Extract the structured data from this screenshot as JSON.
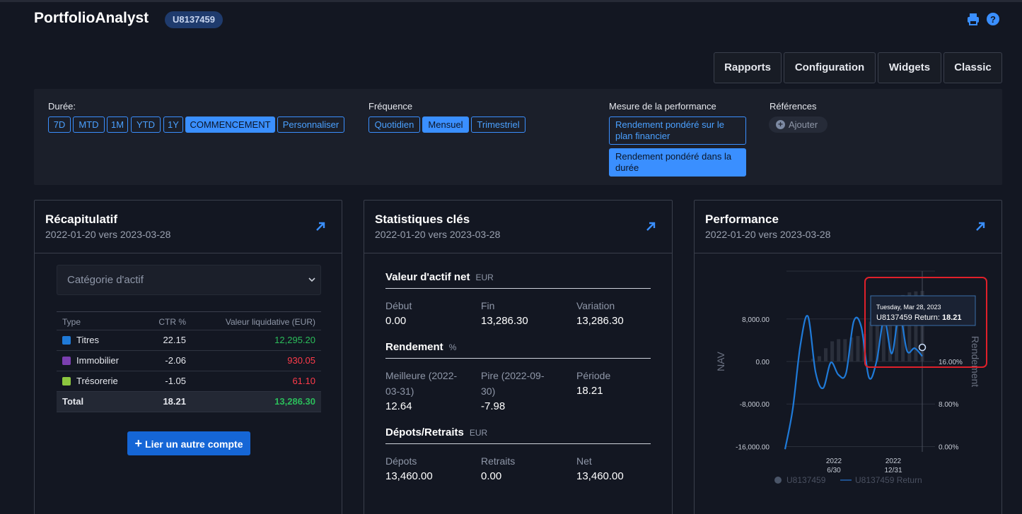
{
  "header": {
    "app_title": "PortfolioAnalyst",
    "account_badge": "U8137459",
    "icons": [
      "print-icon",
      "help-icon"
    ]
  },
  "nav": {
    "buttons": [
      "Rapports",
      "Configuration",
      "Widgets",
      "Classic"
    ]
  },
  "filters": {
    "duration": {
      "label": "Durée:",
      "options": [
        "7D",
        "MTD",
        "1M",
        "YTD",
        "1Y",
        "COMMENCEMENT",
        "Personnaliser"
      ],
      "selected": "COMMENCEMENT"
    },
    "frequency": {
      "label": "Fréquence",
      "options": [
        "Quotidien",
        "Mensuel",
        "Trimestriel"
      ],
      "selected": "Mensuel"
    },
    "measure": {
      "label": "Mesure de la performance",
      "options": [
        "Rendement pondéré sur le plan financier",
        "Rendement pondéré dans la durée"
      ],
      "selected": "Rendement pondéré dans la durée"
    },
    "references": {
      "label": "Références",
      "add_label": "Ajouter"
    }
  },
  "summary": {
    "title": "Récapitulatif",
    "subtitle": "2022-01-20 vers 2023-03-28",
    "select_placeholder": "Catégorie d'actif",
    "columns": [
      "Type",
      "CTR %",
      "Valeur liquidative (EUR)"
    ],
    "rows": [
      {
        "type": "Titres",
        "ctr": "22.15",
        "value": "12,295.20",
        "swatch": "#1f7ad8",
        "value_color": "green"
      },
      {
        "type": "Immobilier",
        "ctr": "-2.06",
        "value": "930.05",
        "swatch": "#7b3fb0",
        "value_color": "red"
      },
      {
        "type": "Trésorerie",
        "ctr": "-1.05",
        "value": "61.10",
        "swatch": "#8cc63f",
        "value_color": "red"
      }
    ],
    "total": {
      "type": "Total",
      "ctr": "18.21",
      "value": "13,286.30"
    },
    "link_button": "Lier un autre compte"
  },
  "stats": {
    "title": "Statistiques clés",
    "subtitle": "2022-01-20 vers 2023-03-28",
    "nav_section": {
      "title": "Valeur d'actif net",
      "unit": "EUR",
      "items": [
        {
          "label": "Début",
          "value": "0.00"
        },
        {
          "label": "Fin",
          "value": "13,286.30"
        },
        {
          "label": "Variation",
          "value": "13,286.30"
        }
      ]
    },
    "return_section": {
      "title": "Rendement",
      "unit": "%",
      "items": [
        {
          "label": "Meilleure (2022-03-31)",
          "value": "12.64"
        },
        {
          "label": "Pire (2022-09-30)",
          "value": "-7.98"
        },
        {
          "label": "Période",
          "value": "18.21"
        }
      ]
    },
    "flow_section": {
      "title": "Dépots/Retraits",
      "unit": "EUR",
      "items": [
        {
          "label": "Dépots",
          "value": "13,460.00"
        },
        {
          "label": "Retraits",
          "value": "0.00"
        },
        {
          "label": "Net",
          "value": "13,460.00"
        }
      ]
    }
  },
  "performance": {
    "title": "Performance",
    "subtitle": "2022-01-20 vers 2023-03-28",
    "tooltip": {
      "date": "Tuesday, Mar 28, 2023",
      "series_label": "U8137459 Return:",
      "value": "18.21"
    }
  },
  "chart_data": {
    "type": "line",
    "x_tick_labels": [
      [
        "2022",
        "6/30"
      ],
      [
        "2022",
        "12/31"
      ]
    ],
    "left_axis": {
      "label": "NAV",
      "ticks": [
        "8,000.00",
        "0.00",
        "-8,000.00",
        "-16,000.00"
      ],
      "tick_values": [
        8000,
        0,
        -8000,
        -16000
      ],
      "ylim": [
        -17000,
        17000
      ]
    },
    "right_axis": {
      "label": "Rendement",
      "ticks": [
        "16.00%",
        "8.00%",
        "0.00%"
      ],
      "tick_values": [
        16,
        8,
        0
      ]
    },
    "series": [
      {
        "name": "U8137459",
        "type": "bar",
        "color": "#2a2f3b",
        "values": [
          0,
          0,
          0,
          500,
          1000,
          2500,
          3800,
          4200,
          4200,
          4500,
          4800,
          5200,
          7500,
          9000,
          9600,
          10500,
          11500,
          12500,
          13000,
          13200,
          13286.3
        ]
      },
      {
        "name": "U8137459 Return",
        "type": "line",
        "color": "#1f7ad8",
        "values": [
          -16500,
          -9000,
          3000,
          8500,
          -2000,
          -5000,
          -200,
          -2500,
          -2200,
          7500,
          6500,
          -3000,
          0,
          8000,
          1500,
          9000,
          2000,
          2500,
          1000
        ]
      }
    ],
    "legend": [
      "U8137459",
      "U8137459 Return"
    ],
    "legend_position": "bottom",
    "highlight_box_color": "#e0202a"
  }
}
